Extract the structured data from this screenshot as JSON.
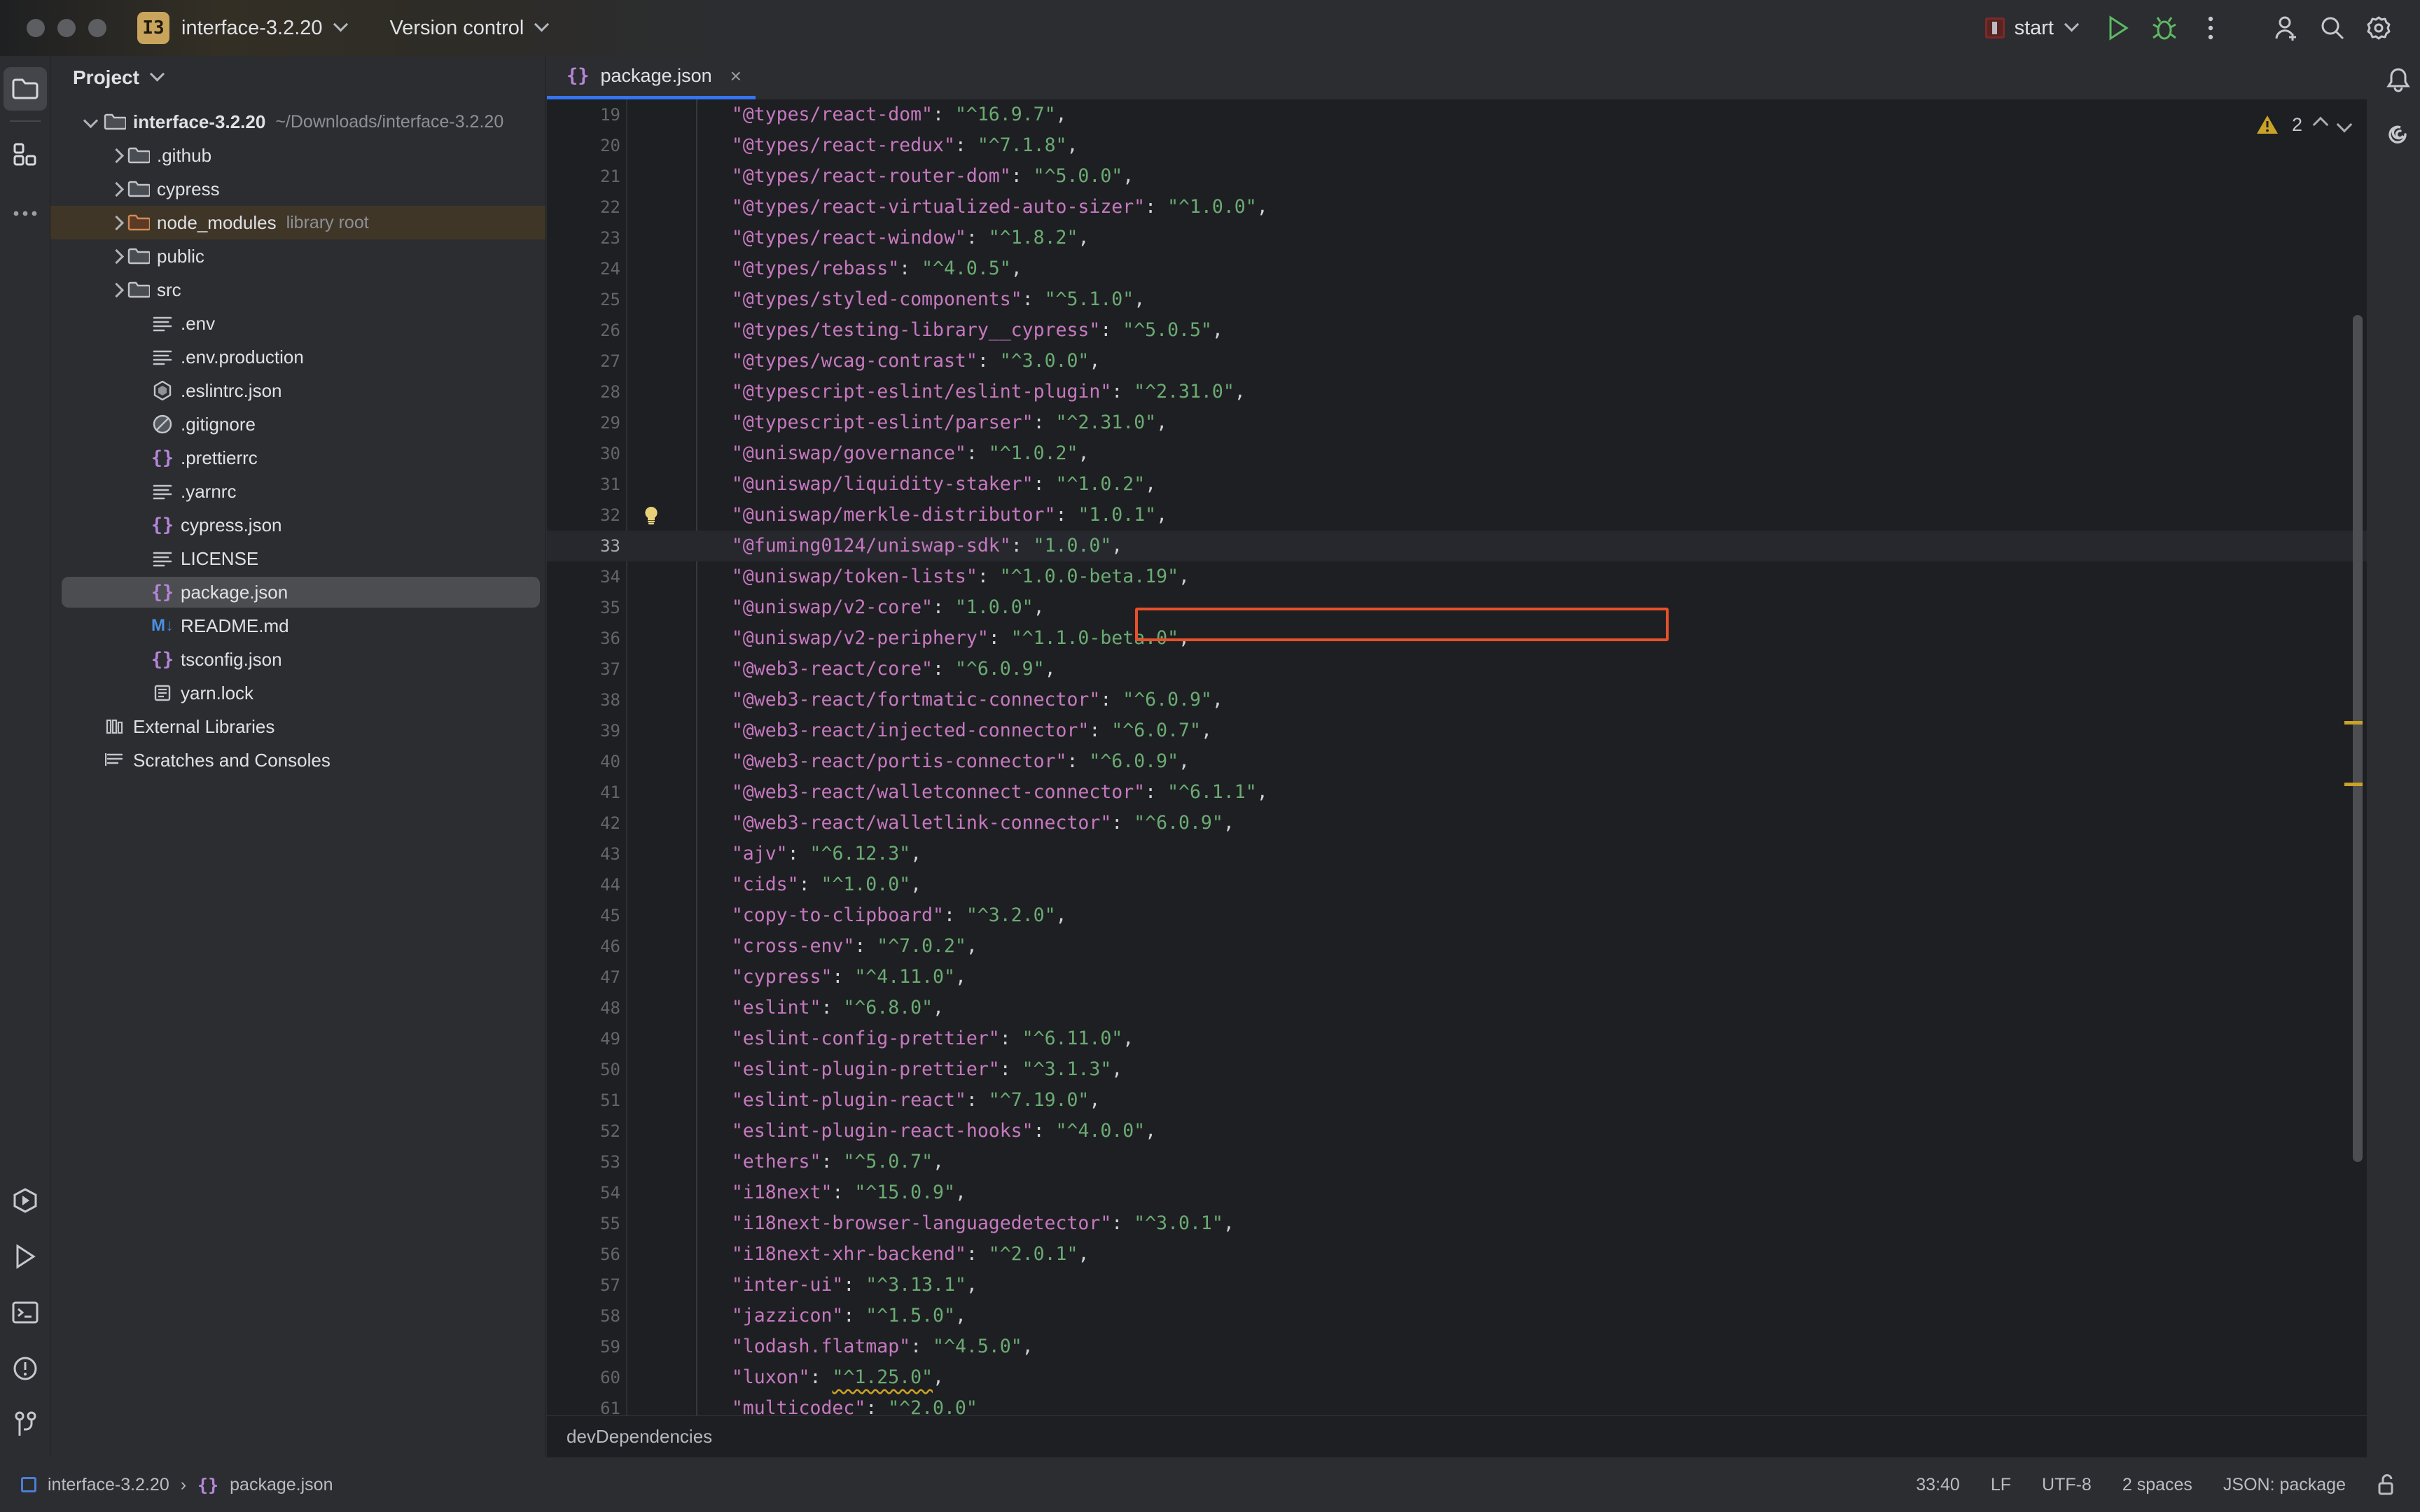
{
  "titlebar": {
    "project_badge": "I3",
    "project_name": "interface-3.2.20",
    "version_control": "Version control",
    "run_config": "start",
    "icons": {
      "run": "run-icon",
      "debug": "debug-icon",
      "more": "more-options-icon",
      "account": "account-icon",
      "search": "search-icon",
      "settings": "settings-icon"
    }
  },
  "activitybar": {
    "top": [
      {
        "name": "project-tool-window",
        "icon": "folder-icon",
        "active": true
      },
      {
        "name": "structure-tool-window",
        "icon": "blocks-icon",
        "active": false
      },
      {
        "name": "more-tool-windows",
        "icon": "ellipsis-icon",
        "active": false
      }
    ],
    "bottom": [
      {
        "name": "run-anything",
        "icon": "run-hex-icon"
      },
      {
        "name": "run-tool-window",
        "icon": "play-icon"
      },
      {
        "name": "terminal-tool-window",
        "icon": "terminal-icon"
      },
      {
        "name": "problems-tool-window",
        "icon": "warning-circle-icon"
      },
      {
        "name": "version-control-tool-window",
        "icon": "branch-icon"
      }
    ]
  },
  "project_panel": {
    "title": "Project",
    "tree": [
      {
        "label": "interface-3.2.20",
        "sublabel": "~/Downloads/interface-3.2.20",
        "icon": "folder-icon",
        "arrow": "down",
        "indent": 0,
        "bold": true
      },
      {
        "label": ".github",
        "sublabel": "",
        "icon": "folder-icon",
        "arrow": "right",
        "indent": 1
      },
      {
        "label": "cypress",
        "sublabel": "",
        "icon": "folder-icon",
        "arrow": "right",
        "indent": 1
      },
      {
        "label": "node_modules",
        "sublabel": "library root",
        "icon": "folder-orange-icon",
        "arrow": "right",
        "indent": 1,
        "highlight": "orange"
      },
      {
        "label": "public",
        "sublabel": "",
        "icon": "folder-icon",
        "arrow": "right",
        "indent": 1
      },
      {
        "label": "src",
        "sublabel": "",
        "icon": "folder-icon",
        "arrow": "right",
        "indent": 1
      },
      {
        "label": ".env",
        "sublabel": "",
        "icon": "text-file-icon",
        "arrow": "",
        "indent": 2
      },
      {
        "label": ".env.production",
        "sublabel": "",
        "icon": "text-file-icon",
        "arrow": "",
        "indent": 2
      },
      {
        "label": ".eslintrc.json",
        "sublabel": "",
        "icon": "eslint-icon",
        "arrow": "",
        "indent": 2
      },
      {
        "label": ".gitignore",
        "sublabel": "",
        "icon": "ignore-icon",
        "arrow": "",
        "indent": 2
      },
      {
        "label": ".prettierrc",
        "sublabel": "",
        "icon": "json-icon",
        "arrow": "",
        "indent": 2
      },
      {
        "label": ".yarnrc",
        "sublabel": "",
        "icon": "text-file-icon",
        "arrow": "",
        "indent": 2
      },
      {
        "label": "cypress.json",
        "sublabel": "",
        "icon": "json-icon",
        "arrow": "",
        "indent": 2
      },
      {
        "label": "LICENSE",
        "sublabel": "",
        "icon": "text-file-icon",
        "arrow": "",
        "indent": 2
      },
      {
        "label": "package.json",
        "sublabel": "",
        "icon": "json-icon",
        "arrow": "",
        "indent": 2,
        "selected": true
      },
      {
        "label": "README.md",
        "sublabel": "",
        "icon": "markdown-icon",
        "arrow": "",
        "indent": 2
      },
      {
        "label": "tsconfig.json",
        "sublabel": "",
        "icon": "json-icon",
        "arrow": "",
        "indent": 2
      },
      {
        "label": "yarn.lock",
        "sublabel": "",
        "icon": "lock-file-icon",
        "arrow": "",
        "indent": 2
      },
      {
        "label": "External Libraries",
        "sublabel": "",
        "icon": "libraries-icon",
        "arrow": "",
        "indent": 0
      },
      {
        "label": "Scratches and Consoles",
        "sublabel": "",
        "icon": "scratches-icon",
        "arrow": "",
        "indent": 0
      }
    ]
  },
  "editor": {
    "tab": {
      "label": "package.json",
      "icon": "json-icon",
      "close": "×"
    },
    "warnings": {
      "count": "2",
      "icon": "warning-triangle-icon"
    },
    "breadcrumb": "devDependencies",
    "highlighted_line": 33,
    "lines": [
      {
        "n": 19,
        "indent": 4,
        "key": "\"@types/react-dom\"",
        "value": "\"^16.9.7\"",
        "comma": true
      },
      {
        "n": 20,
        "indent": 4,
        "key": "\"@types/react-redux\"",
        "value": "\"^7.1.8\"",
        "comma": true
      },
      {
        "n": 21,
        "indent": 4,
        "key": "\"@types/react-router-dom\"",
        "value": "\"^5.0.0\"",
        "comma": true
      },
      {
        "n": 22,
        "indent": 4,
        "key": "\"@types/react-virtualized-auto-sizer\"",
        "value": "\"^1.0.0\"",
        "comma": true
      },
      {
        "n": 23,
        "indent": 4,
        "key": "\"@types/react-window\"",
        "value": "\"^1.8.2\"",
        "comma": true
      },
      {
        "n": 24,
        "indent": 4,
        "key": "\"@types/rebass\"",
        "value": "\"^4.0.5\"",
        "comma": true
      },
      {
        "n": 25,
        "indent": 4,
        "key": "\"@types/styled-components\"",
        "value": "\"^5.1.0\"",
        "comma": true
      },
      {
        "n": 26,
        "indent": 4,
        "key": "\"@types/testing-library__cypress\"",
        "value": "\"^5.0.5\"",
        "comma": true
      },
      {
        "n": 27,
        "indent": 4,
        "key": "\"@types/wcag-contrast\"",
        "value": "\"^3.0.0\"",
        "comma": true
      },
      {
        "n": 28,
        "indent": 4,
        "key": "\"@typescript-eslint/eslint-plugin\"",
        "value": "\"^2.31.0\"",
        "comma": true
      },
      {
        "n": 29,
        "indent": 4,
        "key": "\"@typescript-eslint/parser\"",
        "value": "\"^2.31.0\"",
        "comma": true
      },
      {
        "n": 30,
        "indent": 4,
        "key": "\"@uniswap/governance\"",
        "value": "\"^1.0.2\"",
        "comma": true
      },
      {
        "n": 31,
        "indent": 4,
        "key": "\"@uniswap/liquidity-staker\"",
        "value": "\"^1.0.2\"",
        "comma": true
      },
      {
        "n": 32,
        "indent": 4,
        "key": "\"@uniswap/merkle-distributor\"",
        "value": "\"1.0.1\"",
        "comma": true,
        "bulb": true
      },
      {
        "n": 33,
        "indent": 4,
        "key": "\"@fuming0124/uniswap-sdk\"",
        "value": "\"1.0.0\"",
        "comma": true,
        "current": true,
        "boxed": true
      },
      {
        "n": 34,
        "indent": 4,
        "key": "\"@uniswap/token-lists\"",
        "value": "\"^1.0.0-beta.19\"",
        "comma": true
      },
      {
        "n": 35,
        "indent": 4,
        "key": "\"@uniswap/v2-core\"",
        "value": "\"1.0.0\"",
        "comma": true
      },
      {
        "n": 36,
        "indent": 4,
        "key": "\"@uniswap/v2-periphery\"",
        "value": "\"^1.1.0-beta.0\"",
        "comma": true
      },
      {
        "n": 37,
        "indent": 4,
        "key": "\"@web3-react/core\"",
        "value": "\"^6.0.9\"",
        "comma": true
      },
      {
        "n": 38,
        "indent": 4,
        "key": "\"@web3-react/fortmatic-connector\"",
        "value": "\"^6.0.9\"",
        "comma": true
      },
      {
        "n": 39,
        "indent": 4,
        "key": "\"@web3-react/injected-connector\"",
        "value": "\"^6.0.7\"",
        "comma": true
      },
      {
        "n": 40,
        "indent": 4,
        "key": "\"@web3-react/portis-connector\"",
        "value": "\"^6.0.9\"",
        "comma": true
      },
      {
        "n": 41,
        "indent": 4,
        "key": "\"@web3-react/walletconnect-connector\"",
        "value": "\"^6.1.1\"",
        "comma": true
      },
      {
        "n": 42,
        "indent": 4,
        "key": "\"@web3-react/walletlink-connector\"",
        "value": "\"^6.0.9\"",
        "comma": true
      },
      {
        "n": 43,
        "indent": 4,
        "key": "\"ajv\"",
        "value": "\"^6.12.3\"",
        "comma": true
      },
      {
        "n": 44,
        "indent": 4,
        "key": "\"cids\"",
        "value": "\"^1.0.0\"",
        "comma": true
      },
      {
        "n": 45,
        "indent": 4,
        "key": "\"copy-to-clipboard\"",
        "value": "\"^3.2.0\"",
        "comma": true
      },
      {
        "n": 46,
        "indent": 4,
        "key": "\"cross-env\"",
        "value": "\"^7.0.2\"",
        "comma": true
      },
      {
        "n": 47,
        "indent": 4,
        "key": "\"cypress\"",
        "value": "\"^4.11.0\"",
        "comma": true
      },
      {
        "n": 48,
        "indent": 4,
        "key": "\"eslint\"",
        "value": "\"^6.8.0\"",
        "comma": true
      },
      {
        "n": 49,
        "indent": 4,
        "key": "\"eslint-config-prettier\"",
        "value": "\"^6.11.0\"",
        "comma": true
      },
      {
        "n": 50,
        "indent": 4,
        "key": "\"eslint-plugin-prettier\"",
        "value": "\"^3.1.3\"",
        "comma": true
      },
      {
        "n": 51,
        "indent": 4,
        "key": "\"eslint-plugin-react\"",
        "value": "\"^7.19.0\"",
        "comma": true
      },
      {
        "n": 52,
        "indent": 4,
        "key": "\"eslint-plugin-react-hooks\"",
        "value": "\"^4.0.0\"",
        "comma": true
      },
      {
        "n": 53,
        "indent": 4,
        "key": "\"ethers\"",
        "value": "\"^5.0.7\"",
        "comma": true
      },
      {
        "n": 54,
        "indent": 4,
        "key": "\"i18next\"",
        "value": "\"^15.0.9\"",
        "comma": true
      },
      {
        "n": 55,
        "indent": 4,
        "key": "\"i18next-browser-languagedetector\"",
        "value": "\"^3.0.1\"",
        "comma": true
      },
      {
        "n": 56,
        "indent": 4,
        "key": "\"i18next-xhr-backend\"",
        "value": "\"^2.0.1\"",
        "comma": true
      },
      {
        "n": 57,
        "indent": 4,
        "key": "\"inter-ui\"",
        "value": "\"^3.13.1\"",
        "comma": true
      },
      {
        "n": 58,
        "indent": 4,
        "key": "\"jazzicon\"",
        "value": "\"^1.5.0\"",
        "comma": true
      },
      {
        "n": 59,
        "indent": 4,
        "key": "\"lodash.flatmap\"",
        "value": "\"^4.5.0\"",
        "comma": true
      },
      {
        "n": 60,
        "indent": 4,
        "key": "\"luxon\"",
        "value": "\"^1.25.0\"",
        "comma": true,
        "warn_value": true
      },
      {
        "n": 61,
        "indent": 4,
        "key": "\"multicodec\"",
        "value": "\"^2.0.0\"",
        "comma": false
      }
    ]
  },
  "statusbar": {
    "project": "interface-3.2.20",
    "separator": "›",
    "file": "package.json",
    "caret": "33:40",
    "line_ending": "LF",
    "encoding": "UTF-8",
    "indent": "2 spaces",
    "schema": "JSON: package",
    "lock_icon": "unlocked-icon"
  },
  "colors": {
    "accent_blue": "#3574f0",
    "warning": "#c9a227",
    "highlight_box": "#e8502a",
    "json_key": "#c679c0",
    "json_value": "#6aab73"
  }
}
